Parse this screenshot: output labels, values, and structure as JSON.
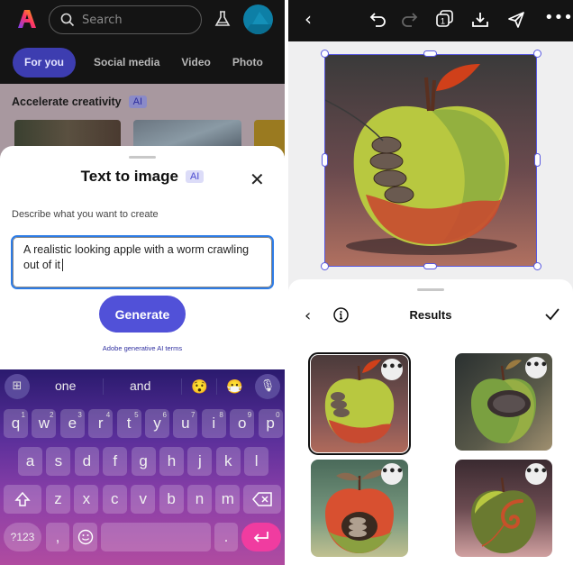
{
  "left_panel": {
    "header": {
      "logo": "adobe-express-logo",
      "search_placeholder": "Search",
      "flask_icon": "flask-icon",
      "avatar": "user-avatar"
    },
    "tabs": [
      {
        "label": "For you",
        "active": true
      },
      {
        "label": "Social media",
        "active": false
      },
      {
        "label": "Video",
        "active": false
      },
      {
        "label": "Photo",
        "active": false
      }
    ],
    "section_title": "Accelerate creativity",
    "section_badge": "AI",
    "sheet": {
      "title": "Text to image",
      "badge": "AI",
      "close_icon": "close-icon",
      "describe_label": "Describe what you want to create",
      "prompt_value": "A realistic looking apple with a worm crawling out of it",
      "generate_label": "Generate",
      "terms_link": "Adobe generative AI terms"
    },
    "keyboard": {
      "suggestions": [
        "one",
        "and"
      ],
      "emoji_suggestions": [
        "😯",
        "😷"
      ],
      "rows": [
        [
          {
            "k": "q",
            "n": "1"
          },
          {
            "k": "w",
            "n": "2"
          },
          {
            "k": "e",
            "n": "3"
          },
          {
            "k": "r",
            "n": "4"
          },
          {
            "k": "t",
            "n": "5"
          },
          {
            "k": "y",
            "n": "6"
          },
          {
            "k": "u",
            "n": "7"
          },
          {
            "k": "i",
            "n": "8"
          },
          {
            "k": "o",
            "n": "9"
          },
          {
            "k": "p",
            "n": "0"
          }
        ],
        [
          {
            "k": "a"
          },
          {
            "k": "s"
          },
          {
            "k": "d"
          },
          {
            "k": "f"
          },
          {
            "k": "g"
          },
          {
            "k": "h"
          },
          {
            "k": "j"
          },
          {
            "k": "k"
          },
          {
            "k": "l"
          }
        ],
        [
          {
            "k": "z"
          },
          {
            "k": "x"
          },
          {
            "k": "c"
          },
          {
            "k": "v"
          },
          {
            "k": "b"
          },
          {
            "k": "n"
          },
          {
            "k": "m"
          }
        ]
      ],
      "symbols_label": "?123",
      "comma": ",",
      "period": ".",
      "colors": {
        "enter": "#f03ca0"
      }
    }
  },
  "right_panel": {
    "toolbar": {
      "back": "‹",
      "page_count": "1"
    },
    "results": {
      "title": "Results",
      "items": [
        {
          "name": "apple-result-1",
          "selected": true
        },
        {
          "name": "apple-result-2",
          "selected": false
        },
        {
          "name": "apple-result-3",
          "selected": false
        },
        {
          "name": "apple-result-4",
          "selected": false
        }
      ],
      "more_label": "•••"
    }
  },
  "colors": {
    "accent": "#5151d8",
    "selection": "#5858e0",
    "focus": "#2d7ce6"
  }
}
